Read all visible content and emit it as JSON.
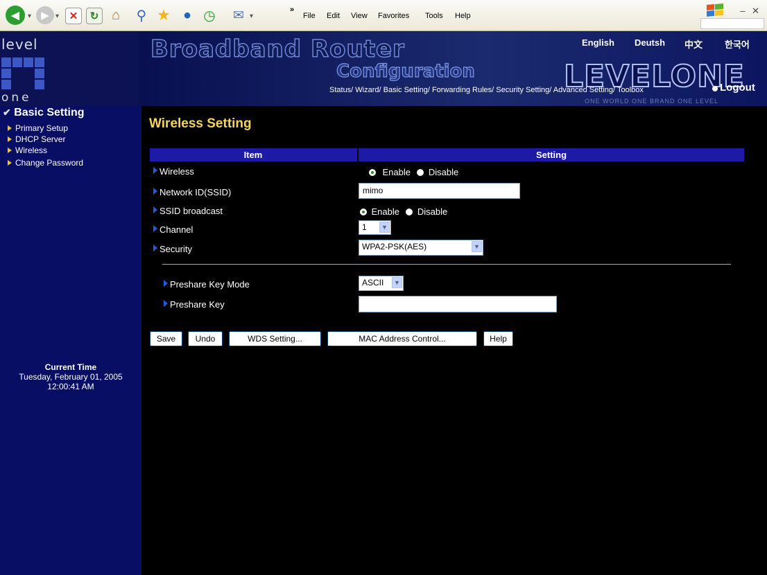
{
  "browser": {
    "menu": [
      "File",
      "Edit",
      "View",
      "Favorites",
      "Tools",
      "Help"
    ],
    "chevron": "»",
    "toolbar_icons": [
      "back-icon",
      "forward-icon",
      "stop-icon",
      "refresh-icon",
      "home-icon",
      "search-icon",
      "favorites-star-icon",
      "media-icon",
      "history-icon",
      "mail-icon"
    ],
    "window_controls": "– ✕"
  },
  "banner": {
    "logo_top": "level",
    "logo_bottom": "one",
    "title_main": "Broadband Router",
    "title_sub": "Configuration",
    "languages": [
      "English",
      "Deutsh",
      "中文",
      "한국어"
    ],
    "brand": "LEVELONE",
    "slogan": "ONE WORLD ONE BRAND ONE LEVEL",
    "nav": "Status/ Wizard/ Basic Setting/ Forwarding Rules/ Security Setting/ Advanced Setting/ Toolbox",
    "logout": "Logout"
  },
  "sidebar": {
    "title": "Basic Setting",
    "items": [
      "Primary Setup",
      "DHCP Server",
      "Wireless",
      "Change Password"
    ],
    "time_label": "Current Time",
    "time_date": "Tuesday, February 01, 2005",
    "time_clock": "12:00:41 AM"
  },
  "main": {
    "title": "Wireless Setting",
    "col_item": "Item",
    "col_setting": "Setting",
    "rows": {
      "wireless": {
        "label": "Wireless",
        "enable": "Enable",
        "disable": "Disable"
      },
      "ssid": {
        "label": "Network ID(SSID)",
        "value": "mimo"
      },
      "broadcast": {
        "label": "SSID broadcast",
        "enable": "Enable",
        "disable": "Disable"
      },
      "channel": {
        "label": "Channel",
        "value": "1"
      },
      "security": {
        "label": "Security",
        "value": "WPA2-PSK(AES)"
      },
      "key_mode": {
        "label": "Preshare Key Mode",
        "value": "ASCII"
      },
      "key": {
        "label": "Preshare Key",
        "value": ""
      }
    },
    "buttons": {
      "save": "Save",
      "undo": "Undo",
      "wds": "WDS Setting...",
      "mac": "MAC Address Control...",
      "help": "Help"
    }
  }
}
